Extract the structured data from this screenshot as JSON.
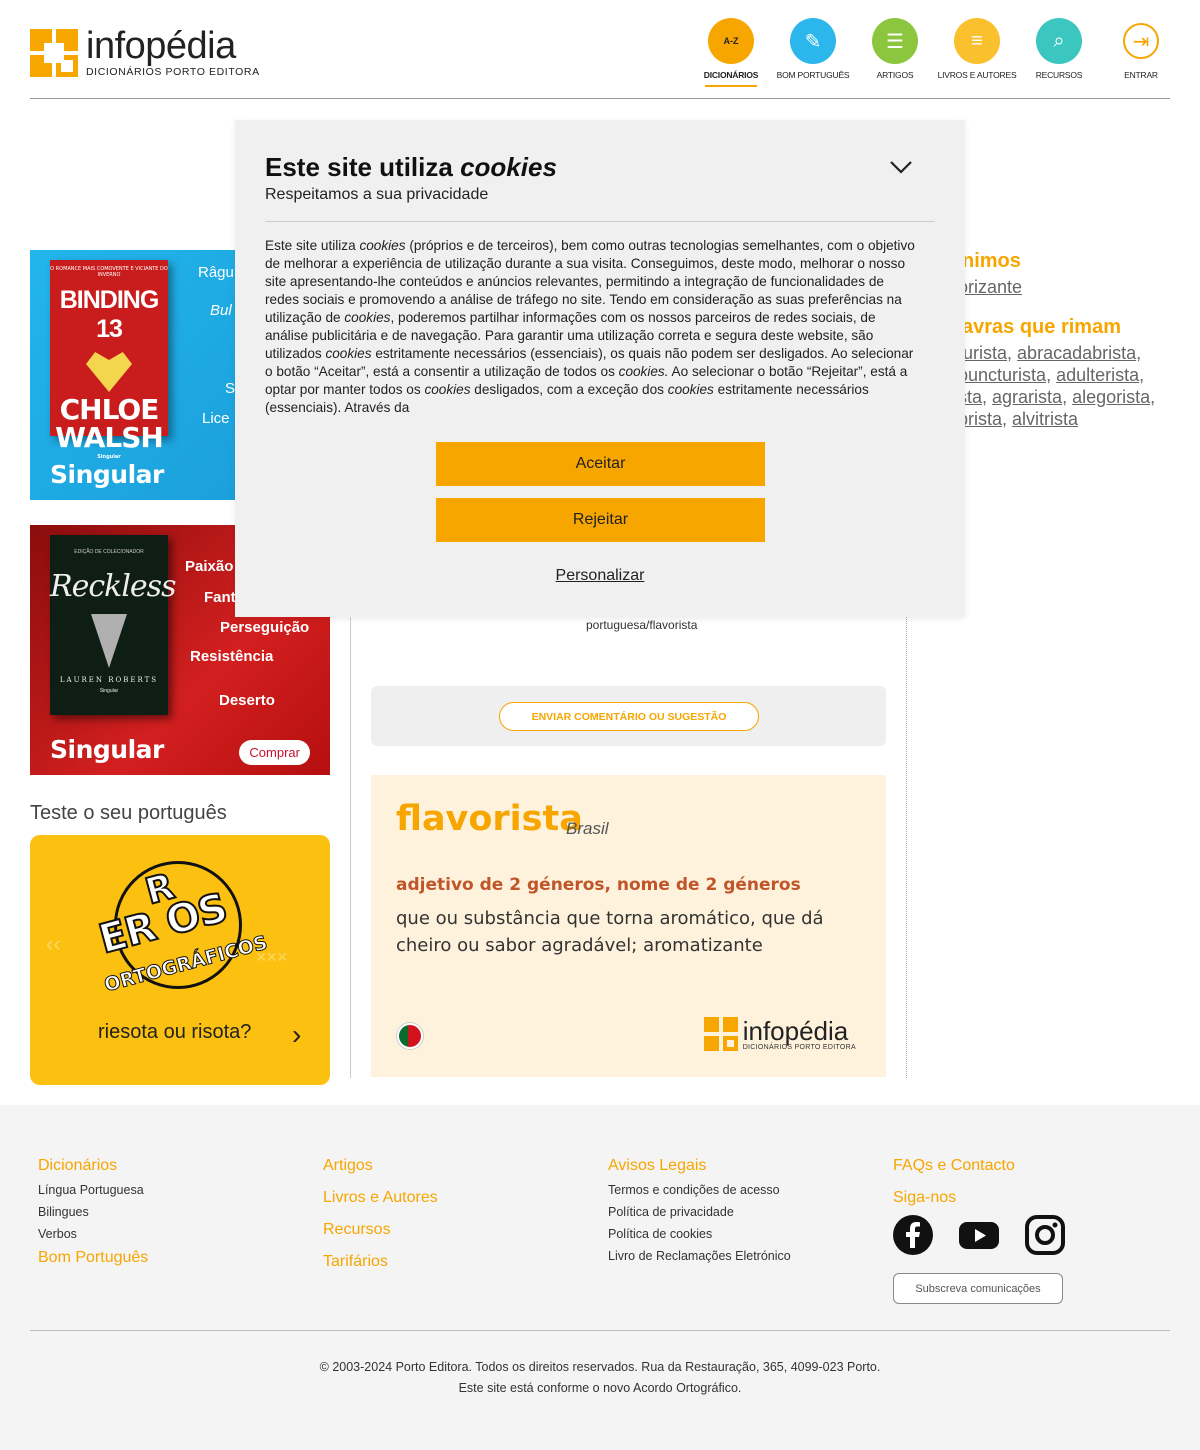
{
  "header": {
    "logo_name": "infopédia",
    "logo_sub": "DICIONÁRIOS PORTO EDITORA",
    "nav": [
      {
        "label": "DICIONÁRIOS",
        "icon": "dictionary-icon",
        "color": "#f7a600",
        "active": true
      },
      {
        "label": "BOM PORTUGUÊS",
        "icon": "checklist-icon",
        "color": "#2bb6ec"
      },
      {
        "label": "ARTIGOS",
        "icon": "document-icon",
        "color": "#8cc63f"
      },
      {
        "label": "LIVROS E AUTORES",
        "icon": "books-icon",
        "color": "#fbc02d"
      },
      {
        "label": "RECURSOS",
        "icon": "search-doc-icon",
        "color": "#3cc6c0"
      },
      {
        "label": "ENTRAR",
        "icon": "login-icon",
        "color": "#f7a600"
      }
    ]
  },
  "ads": {
    "ad1": {
      "book_top": "O ROMANCE MAIS COMOVENTE E VICIANTE DO INVERNO",
      "book_title": "BINDING 13",
      "book_author": "CHLOE WALSH",
      "book_brand": "Singular",
      "words": [
        "Râgu",
        "Bul",
        "S",
        "Lice"
      ],
      "brand": "Singular"
    },
    "ad2": {
      "book_top": "EDIÇÃO DE COLECIONADOR",
      "book_title": "Reckless",
      "book_author": "LAUREN ROBERTS",
      "book_brand": "Singular",
      "words": [
        "Paixão",
        "Fant",
        "Perseguição",
        "Resistência",
        "Deserto"
      ],
      "brand": "Singular",
      "buy_label": "Comprar"
    }
  },
  "test": {
    "title": "Teste o seu português",
    "card_title_1": "ER OS",
    "card_r": "R",
    "card_title_2": "ORTOGRÁFICOS",
    "question": "riesota ou risota?"
  },
  "main": {
    "url": "portuguesa/flavorista",
    "comment_label": "ENVIAR COMENTÁRIO OU SUGESTÃO",
    "word": "flavorista",
    "variant": "Brasil",
    "word_class": "adjetivo de 2 géneros, nome de 2 géneros",
    "definition": "que ou substância que torna aromático, que dá cheiro ou sabor agradável; aromatizante"
  },
  "side": {
    "synonyms_head": "nimos",
    "synonyms": [
      "orizante"
    ],
    "rhymes_head": "avras que rimam",
    "rhymes": [
      [
        "turista",
        "abracadabrista"
      ],
      [
        "puncturista",
        "adulterista"
      ],
      [
        "sta",
        "agrarista",
        "alegorista"
      ],
      [
        "brista",
        "alvitrista"
      ]
    ]
  },
  "footer": {
    "col1": {
      "head": "Dicionários",
      "links": [
        "Língua Portuguesa",
        "Bilingues",
        "Verbos"
      ],
      "head2": "Bom Português"
    },
    "col2": {
      "heads": [
        "Artigos",
        "Livros e Autores",
        "Recursos",
        "Tarifários"
      ]
    },
    "col3": {
      "head": "Avisos Legais",
      "links": [
        "Termos e condições de acesso",
        "Política de privacidade",
        "Política de cookies",
        "Livro de Reclamações Eletrónico"
      ]
    },
    "col4": {
      "head": "FAQs e Contacto",
      "head2": "Siga-nos",
      "social": [
        "facebook-icon",
        "youtube-icon",
        "instagram-icon"
      ],
      "subscribe": "Subscreva comunicações"
    },
    "copyright_1": "© 2003-2024 Porto Editora. Todos os direitos reservados. Rua da Restauração, 365, 4099-023 Porto.",
    "copyright_2": "Este site está conforme o novo Acordo Ortográfico."
  },
  "cookie": {
    "title_plain": "Este site utiliza ",
    "title_italic": "cookies",
    "subtitle": "Respeitamos a sua privacidade",
    "body": [
      {
        "t": "Este site utiliza "
      },
      {
        "t": "cookies",
        "i": true
      },
      {
        "t": " (próprios e de terceiros), bem como outras tecnologias semelhantes, com o objetivo de melhorar a experiência de utilização durante a sua visita. Conseguimos, deste modo, melhorar o nosso site apresentando-lhe conteúdos e anúncios relevantes, permitindo a integração de funcionalidades de redes sociais e promovendo a análise de tráfego no site. Tendo em consideração as suas preferências na utilização de "
      },
      {
        "t": "cookies",
        "i": true
      },
      {
        "t": ", poderemos partilhar informações com os nossos parceiros de redes sociais, de análise publicitária e de navegação. Para garantir uma utilização correta e segura deste website, são utilizados "
      },
      {
        "t": "cookies",
        "i": true
      },
      {
        "t": " estritamente necessários (essenciais), os quais não podem ser desligados. Ao selecionar o botão “Aceitar”, está a consentir a utilização de todos os "
      },
      {
        "t": "cookies.",
        "i": true
      },
      {
        "t": " Ao selecionar o botão “Rejeitar”, está a optar por manter todos os "
      },
      {
        "t": "cookies",
        "i": true
      },
      {
        "t": " desligados, com a exceção dos "
      },
      {
        "t": "cookies",
        "i": true
      },
      {
        "t": " estritamente necessários (essenciais). Através da"
      }
    ],
    "accept": "Aceitar",
    "reject": "Rejeitar",
    "customize": "Personalizar"
  }
}
